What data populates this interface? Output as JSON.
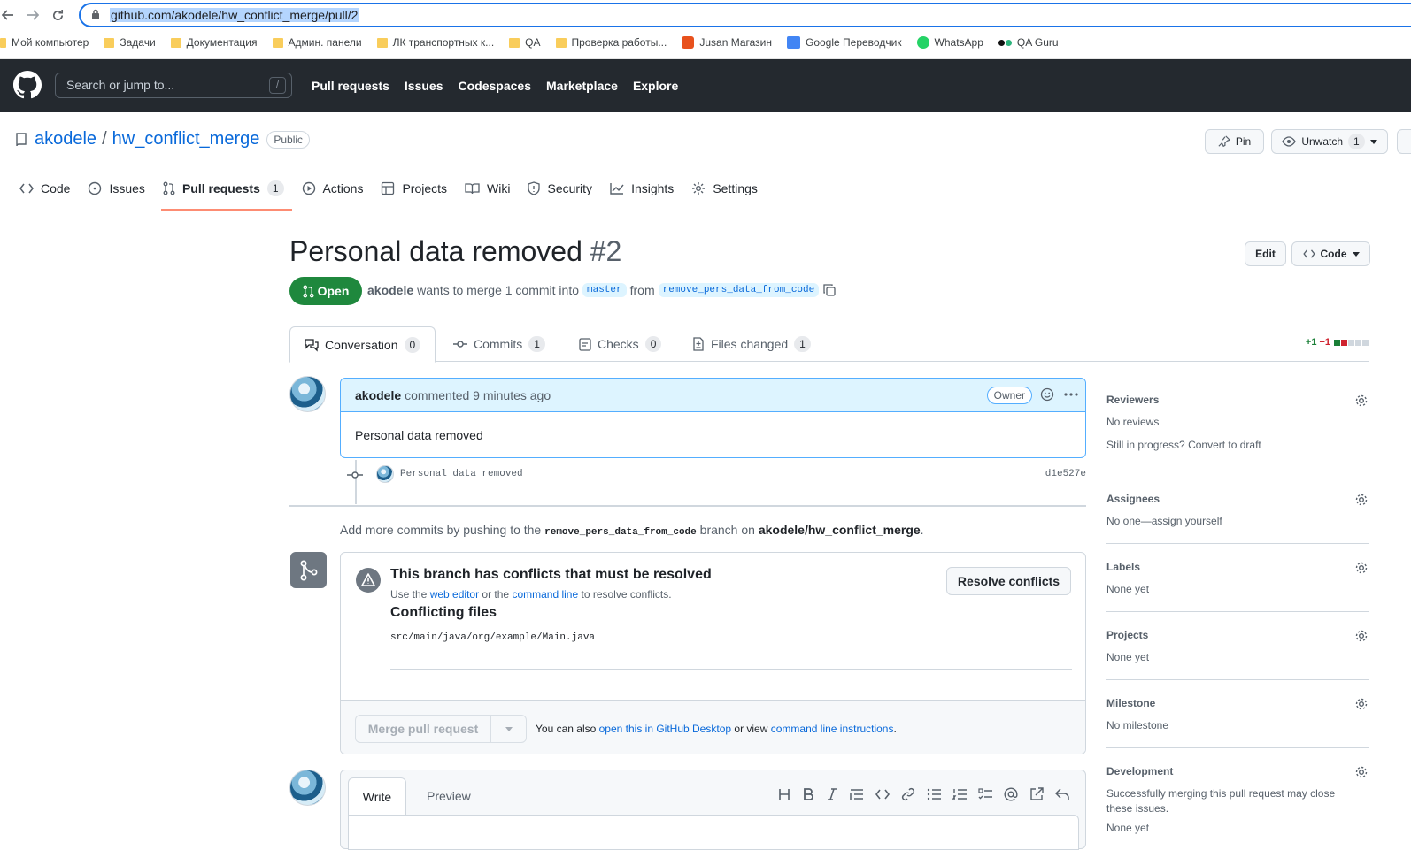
{
  "browser": {
    "url": "github.com/akodele/hw_conflict_merge/pull/2",
    "bookmarks": [
      "Мой компьютер",
      "Задачи",
      "Документация",
      "Админ. панели",
      "ЛК транспортных к...",
      "QA",
      "Проверка работы...",
      "Jusan Магазин",
      "Google Переводчик",
      "WhatsApp",
      "QA Guru"
    ]
  },
  "header": {
    "search_placeholder": "Search or jump to...",
    "search_key": "/",
    "nav": [
      "Pull requests",
      "Issues",
      "Codespaces",
      "Marketplace",
      "Explore"
    ]
  },
  "repo": {
    "owner": "akodele",
    "name": "hw_conflict_merge",
    "visibility": "Public",
    "pin_label": "Pin",
    "watch_label": "Unwatch",
    "watch_count": "1",
    "tabs": [
      {
        "label": "Code"
      },
      {
        "label": "Issues"
      },
      {
        "label": "Pull requests",
        "count": "1"
      },
      {
        "label": "Actions"
      },
      {
        "label": "Projects"
      },
      {
        "label": "Wiki"
      },
      {
        "label": "Security"
      },
      {
        "label": "Insights"
      },
      {
        "label": "Settings"
      }
    ]
  },
  "pr": {
    "title": "Personal data removed",
    "number": "#2",
    "edit_label": "Edit",
    "code_label": "Code",
    "state": "Open",
    "author": "akodele",
    "meta_text": "wants to merge 1 commit into",
    "base_branch": "master",
    "from_text": "from",
    "head_branch": "remove_pers_data_from_code",
    "tabs": [
      {
        "label": "Conversation",
        "count": "0"
      },
      {
        "label": "Commits",
        "count": "1"
      },
      {
        "label": "Checks",
        "count": "0"
      },
      {
        "label": "Files changed",
        "count": "1"
      }
    ],
    "additions": "+1",
    "deletions": "−1"
  },
  "comment": {
    "author": "akodele",
    "action": "commented 9 minutes ago",
    "role": "Owner",
    "body": "Personal data removed"
  },
  "commit": {
    "message": "Personal data removed",
    "sha": "d1e527e"
  },
  "add_commits": {
    "prefix": "Add more commits by pushing to the",
    "branch": "remove_pers_data_from_code",
    "middle": "branch on",
    "repo": "akodele/hw_conflict_merge",
    "suffix": "."
  },
  "merge": {
    "conflict_title": "This branch has conflicts that must be resolved",
    "use_the": "Use the",
    "web_editor": "web editor",
    "or_the": "or the",
    "command_line": "command line",
    "to_resolve": "to resolve conflicts.",
    "conflicting_title": "Conflicting files",
    "file": "src/main/java/org/example/Main.java",
    "resolve_label": "Resolve conflicts",
    "merge_label": "Merge pull request",
    "also_text": "You can also",
    "desktop_link": "open this in GitHub Desktop",
    "or_view": "or view",
    "cli_link": "command line instructions",
    "period": "."
  },
  "write": {
    "tab_write": "Write",
    "tab_preview": "Preview"
  },
  "sidebar": {
    "reviewers": {
      "title": "Reviewers",
      "value": "No reviews",
      "hint": "Still in progress?",
      "hint_link": "Convert to draft"
    },
    "assignees": {
      "title": "Assignees",
      "value": "No one—assign yourself"
    },
    "labels": {
      "title": "Labels",
      "value": "None yet"
    },
    "projects": {
      "title": "Projects",
      "value": "None yet"
    },
    "milestone": {
      "title": "Milestone",
      "value": "No milestone"
    },
    "development": {
      "title": "Development",
      "value": "Successfully merging this pull request may close these issues.",
      "value2": "None yet"
    }
  },
  "colors": {
    "accent": "#0969da",
    "open_green": "#1f883d",
    "header_bg": "#24292f",
    "tab_underline": "#fd8c73"
  }
}
